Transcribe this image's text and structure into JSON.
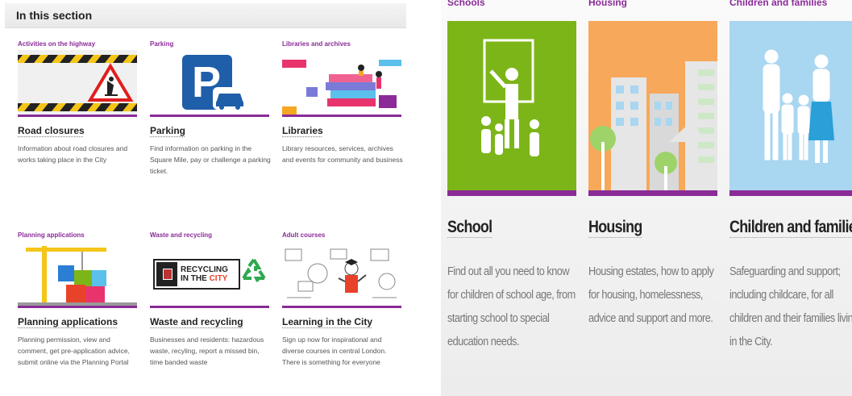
{
  "left": {
    "section_title": "In this section",
    "cards": [
      {
        "category": "Activities on the highway",
        "title": "Road closures",
        "desc": "Information about road closures and works taking place in the City"
      },
      {
        "category": "Parking",
        "title": "Parking",
        "desc": "Find information on parking in the Square Mile, pay or challenge a parking ticket."
      },
      {
        "category": "Libraries and archives",
        "title": "Libraries",
        "desc": "Library resources, services, archives and events for community and business"
      },
      {
        "category": "Planning applications",
        "title": "Planning applications",
        "desc": "Planning permission, view and comment, get pre-application advice, submit online via the Planning Portal"
      },
      {
        "category": "Waste and recycling",
        "title": "Waste and recycling",
        "desc": "Businesses and residents: hazardous waste, recyling, report a missed bin, time banded waste"
      },
      {
        "category": "Adult courses",
        "title": "Learning in the City",
        "desc": "Sign up now for inspirational and diverse courses in central London. There is something for everyone"
      }
    ],
    "recycling_logo": {
      "line1": "RECYCLING",
      "line2a": "IN THE ",
      "line2b": "CITY"
    }
  },
  "right": {
    "cards": [
      {
        "category": "Schools",
        "title": "School",
        "desc": "Find out all you need to know for children of school age, from starting school to special education needs."
      },
      {
        "category": "Housing",
        "title": "Housing",
        "desc": "Housing estates, how to apply for housing, homelessness, advice and support and more."
      },
      {
        "category": "Children and families",
        "title": "Children and families",
        "desc": "Safeguarding and support; including childcare, for all children and their families living in the City."
      }
    ]
  },
  "colors": {
    "accent": "#8a2b98",
    "school_bg": "#7cb518",
    "housing_bg": "#f7a85a",
    "children_bg": "#a9d6f0"
  }
}
